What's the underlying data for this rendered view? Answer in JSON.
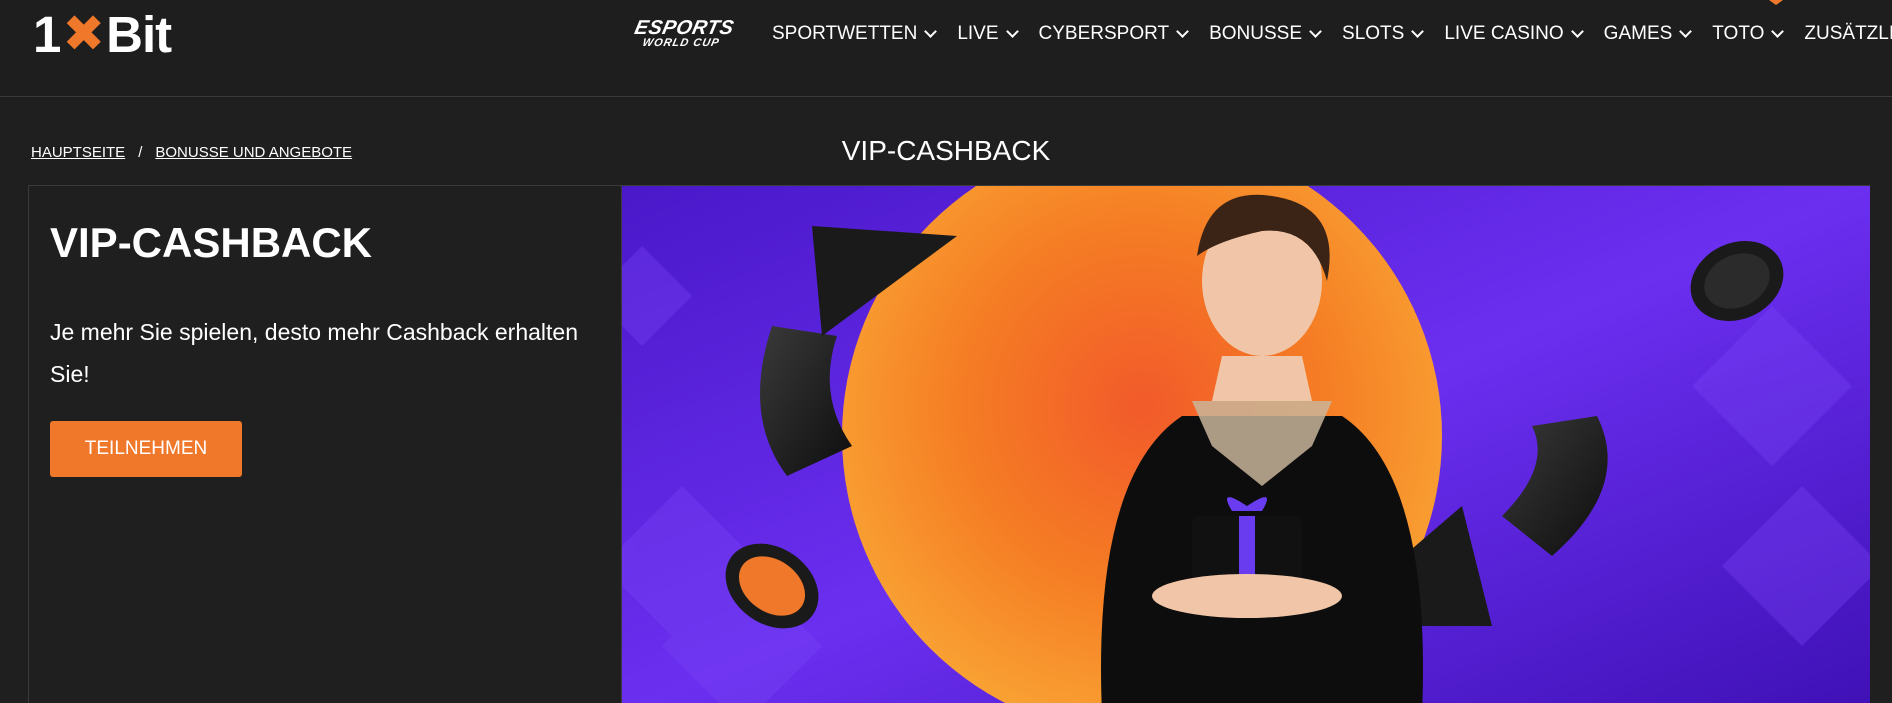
{
  "header": {
    "logo": {
      "left": "1",
      "right": "Bit"
    },
    "esports": {
      "big": "ESPORTS",
      "small": "WORLD CUP"
    },
    "nav": [
      {
        "label": "SPORTWETTEN"
      },
      {
        "label": "LIVE"
      },
      {
        "label": "CYBERSPORT"
      },
      {
        "label": "BONUSSE"
      },
      {
        "label": "SLOTS"
      },
      {
        "label": "LIVE CASINO"
      },
      {
        "label": "GAMES"
      },
      {
        "label": "TOTO"
      },
      {
        "label": "ZUSÄTZLICH"
      }
    ]
  },
  "breadcrumb": {
    "home": "HAUPTSEITE",
    "separator": "/",
    "current": "BONUSSE UND ANGEBOTE"
  },
  "page_title": "VIP-CASHBACK",
  "promo": {
    "title": "VIP-CASHBACK",
    "description": "Je mehr Sie spielen, desto mehr Cashback erhalten Sie!",
    "button_label": "TEILNEHMEN"
  },
  "colors": {
    "accent": "#f0782a",
    "background": "#1f1f1f",
    "banner_purple": "#5a1fd6",
    "banner_orange": "#f5821f"
  },
  "icons": {
    "logo_mark": "1xbit-logo",
    "nav_chevron": "chevron-down-icon"
  }
}
